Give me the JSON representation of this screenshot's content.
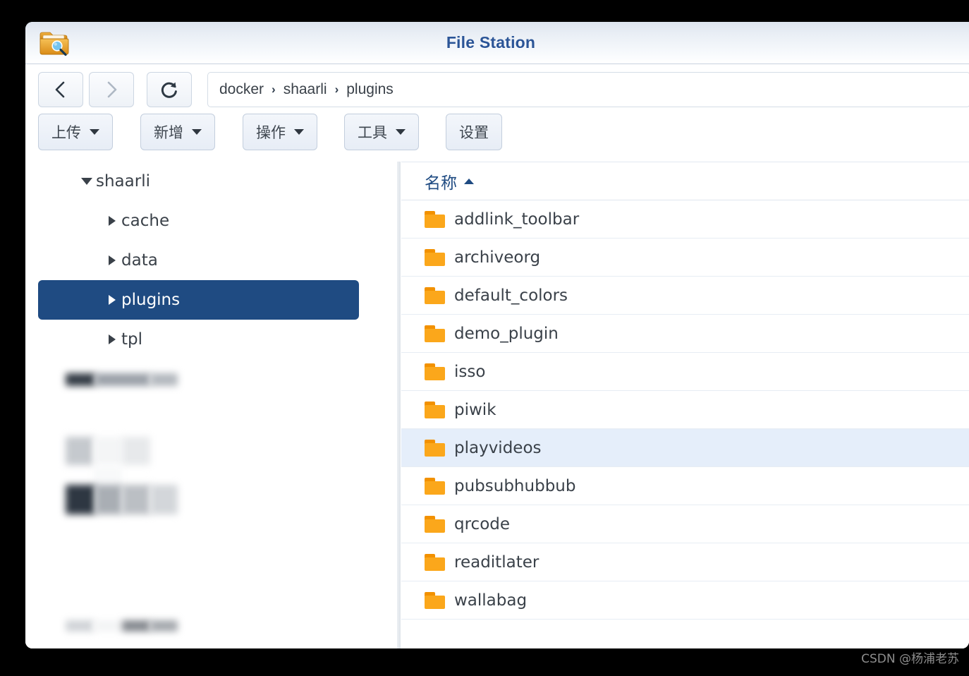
{
  "window": {
    "title": "File Station",
    "app_icon": "folder-search-icon"
  },
  "nav": {
    "back_label": "‹",
    "forward_label": "›",
    "refresh_label": "↻",
    "back_enabled": true,
    "forward_enabled": false
  },
  "breadcrumb": {
    "separator": "›",
    "items": [
      "docker",
      "shaarli",
      "plugins"
    ]
  },
  "toolbar": {
    "buttons": [
      {
        "label": "上传",
        "has_caret": true
      },
      {
        "label": "新增",
        "has_caret": true
      },
      {
        "label": "操作",
        "has_caret": true
      },
      {
        "label": "工具",
        "has_caret": true
      },
      {
        "label": "设置",
        "has_caret": false
      }
    ]
  },
  "sidebar": {
    "tree": [
      {
        "label": "shaarli",
        "depth": 0,
        "state": "expanded",
        "selected": false
      },
      {
        "label": "cache",
        "depth": 1,
        "state": "collapsed",
        "selected": false
      },
      {
        "label": "data",
        "depth": 1,
        "state": "collapsed",
        "selected": false
      },
      {
        "label": "plugins",
        "depth": 1,
        "state": "collapsed",
        "selected": true
      },
      {
        "label": "tpl",
        "depth": 1,
        "state": "collapsed",
        "selected": false
      }
    ]
  },
  "filelist": {
    "columns": [
      {
        "label": "名称",
        "sort": "asc"
      }
    ],
    "rows": [
      {
        "name": "addlink_toolbar",
        "icon": "folder-icon",
        "selected": false
      },
      {
        "name": "archiveorg",
        "icon": "folder-icon",
        "selected": false
      },
      {
        "name": "default_colors",
        "icon": "folder-icon",
        "selected": false
      },
      {
        "name": "demo_plugin",
        "icon": "folder-icon",
        "selected": false
      },
      {
        "name": "isso",
        "icon": "folder-icon",
        "selected": false
      },
      {
        "name": "piwik",
        "icon": "folder-icon",
        "selected": false
      },
      {
        "name": "playvideos",
        "icon": "folder-icon",
        "selected": true
      },
      {
        "name": "pubsubhubbub",
        "icon": "folder-icon",
        "selected": false
      },
      {
        "name": "qrcode",
        "icon": "folder-icon",
        "selected": false
      },
      {
        "name": "readitlater",
        "icon": "folder-icon",
        "selected": false
      },
      {
        "name": "wallabag",
        "icon": "folder-icon",
        "selected": false
      }
    ]
  },
  "watermark": {
    "text": "CSDN @杨浦老苏"
  },
  "colors": {
    "accent": "#1f4b82",
    "title": "#2b5597",
    "folder": "#fba71b",
    "folder_tab": "#f29100",
    "row_selected": "#e5eefa",
    "text": "#3a4149",
    "page_background": "#000000"
  }
}
